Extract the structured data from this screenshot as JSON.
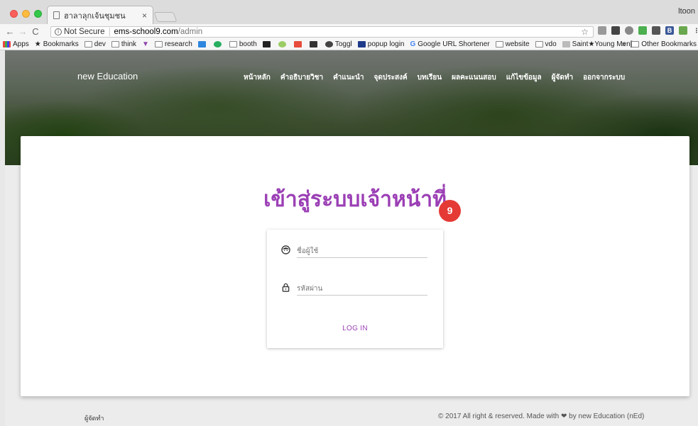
{
  "browser": {
    "tab_title": "ฮาลาลุกเจ้นชุมชน",
    "tab_close": "×",
    "profile_name": "ltoon",
    "security_label": "Not Secure",
    "url_host": "ems-school9.com",
    "url_path": "/admin",
    "bookmarks": [
      "Apps",
      "Bookmarks",
      "dev",
      "think",
      "research",
      "booth",
      "Toggl",
      "popup login",
      "Google URL Shortener",
      "website",
      "vdo",
      "Saint★Young Men[..."
    ],
    "other_bookmarks": "Other Bookmarks",
    "overflow": "»"
  },
  "header": {
    "brand": "new Education",
    "nav_items": [
      "หน้าหลัก",
      "คำอธิบายวิชา",
      "คำแนะนำ",
      "จุดประสงค์",
      "บทเรียน",
      "ผลคะแนนสอบ",
      "แก้ไขข้อมูล",
      "ผู้จัดทำ",
      "ออกจากระบบ"
    ]
  },
  "main": {
    "title": "เข้าสู่ระบบเจ้าหน้าที่",
    "badge": "9",
    "username_placeholder": "ชื่อผู้ใช้",
    "password_placeholder": "รหัสผ่าน",
    "login_label": "LOG IN"
  },
  "footer": {
    "left": "ผู้จัดทำ",
    "right": "© 2017 All right & reserved. Made with ❤ by new Education (nEd)"
  },
  "colors": {
    "accent": "#9b3fb5",
    "badge": "#e53935"
  }
}
